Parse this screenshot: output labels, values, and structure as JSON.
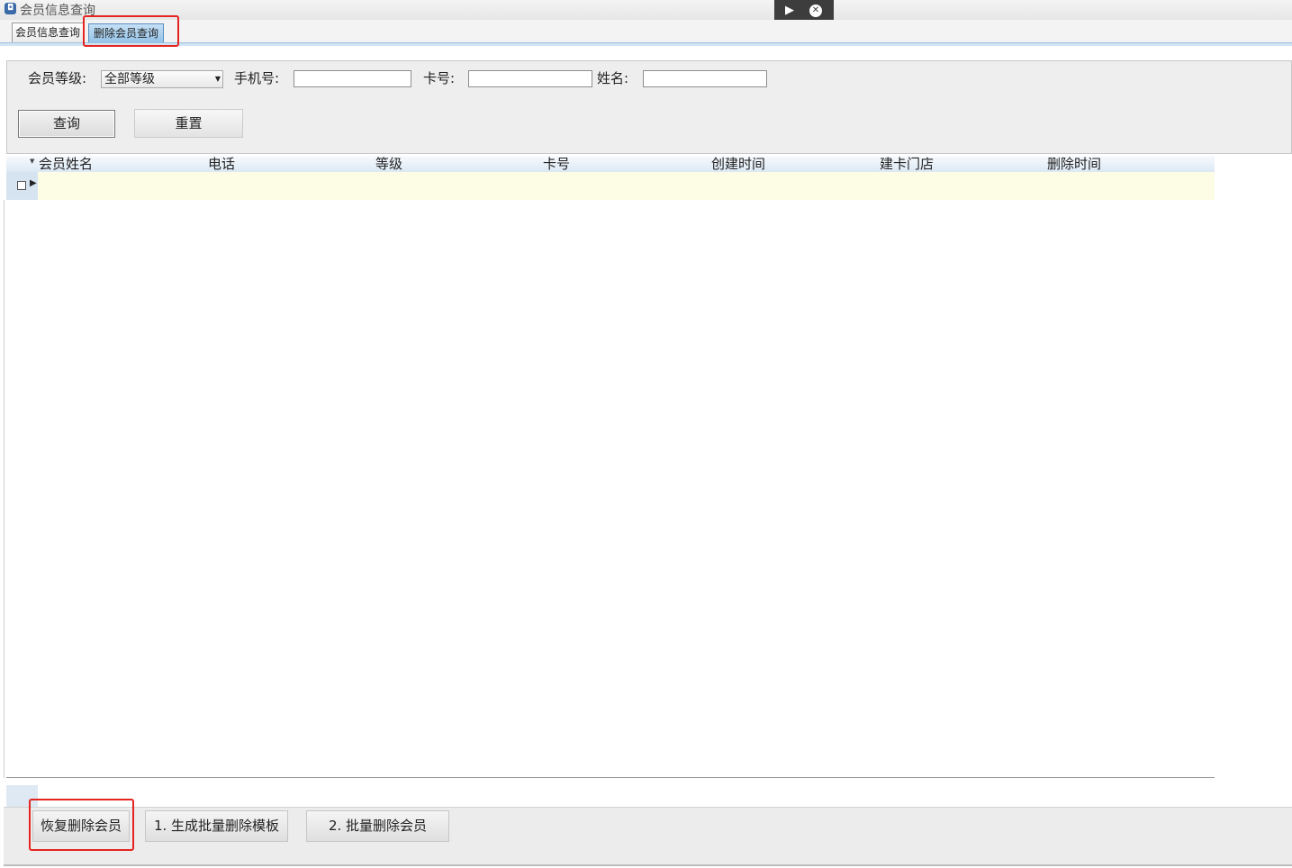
{
  "window": {
    "title": "会员信息查询",
    "app_icon": "app-window-icon",
    "toolbar_icons": [
      "play-icon",
      "close-circle-icon"
    ]
  },
  "tabs": [
    {
      "label": "会员信息查询",
      "active": false
    },
    {
      "label": "删除会员查询",
      "active": true
    }
  ],
  "filter": {
    "level_label": "会员等级:",
    "level_value": "全部等级",
    "phone_label": "手机号:",
    "phone_value": "",
    "card_label": "卡号:",
    "card_value": "",
    "name_label": "姓名:",
    "name_value": "",
    "query_button": "查询",
    "reset_button": "重置"
  },
  "grid": {
    "columns": [
      "会员姓名",
      "电话",
      "等级",
      "卡号",
      "创建时间",
      "建卡门店",
      "删除时间"
    ],
    "rows": []
  },
  "actions": {
    "restore_button": "恢复删除会员",
    "generate_template_button": "1. 生成批量删除模板",
    "batch_delete_button": "2. 批量删除会员"
  },
  "colors": {
    "highlight": "#e52420",
    "active_tab": "#8fc0e6",
    "row_background": "#fdfde5"
  }
}
